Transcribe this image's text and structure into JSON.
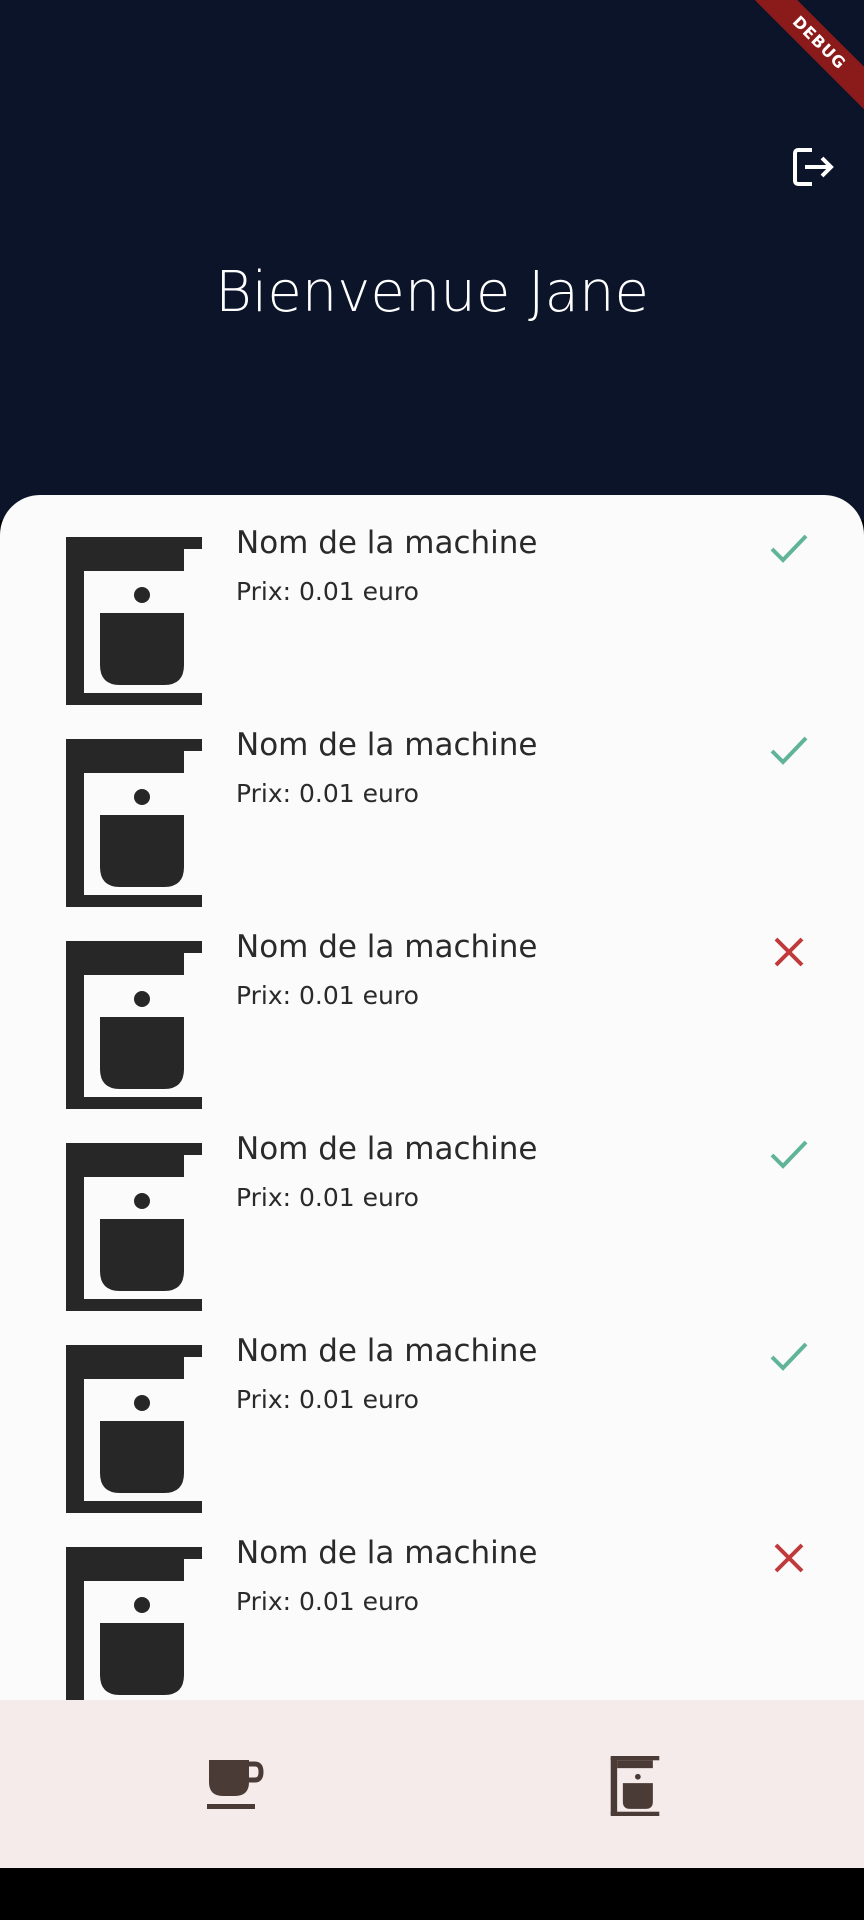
{
  "debug_label": "DEBUG",
  "header": {
    "welcome": "Bienvenue Jane"
  },
  "machines": [
    {
      "name": "Nom de la machine",
      "price": "Prix: 0.01 euro",
      "status": "available",
      "status_icon": "check-icon"
    },
    {
      "name": "Nom de la machine",
      "price": "Prix: 0.01 euro",
      "status": "available",
      "status_icon": "check-icon"
    },
    {
      "name": "Nom de la machine",
      "price": "Prix: 0.01 euro",
      "status": "unavailable",
      "status_icon": "close-icon"
    },
    {
      "name": "Nom de la machine",
      "price": "Prix: 0.01 euro",
      "status": "available",
      "status_icon": "check-icon"
    },
    {
      "name": "Nom de la machine",
      "price": "Prix: 0.01 euro",
      "status": "available",
      "status_icon": "check-icon"
    },
    {
      "name": "Nom de la machine",
      "price": "Prix: 0.01 euro",
      "status": "unavailable",
      "status_icon": "close-icon"
    }
  ],
  "colors": {
    "header_bg": "#0b1429",
    "check": "#5fb49a",
    "cross": "#c0393b",
    "icon_dark": "#272727",
    "nav_bg": "#f5ebea",
    "nav_icon": "#4a3b36"
  }
}
